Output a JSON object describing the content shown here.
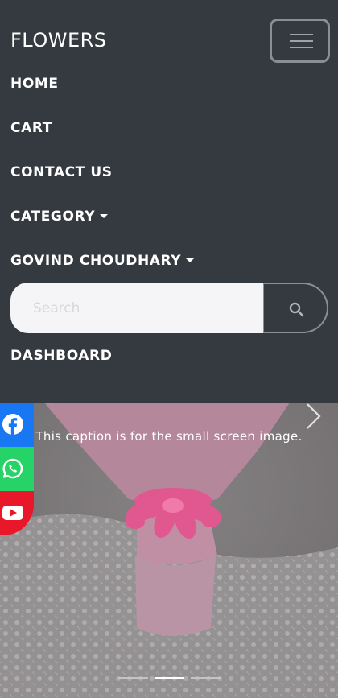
{
  "navbar": {
    "brand": "FLOWERS",
    "items": [
      {
        "label": "HOME"
      },
      {
        "label": "CART"
      },
      {
        "label": "CONTACT US"
      },
      {
        "label": "CATEGORY"
      },
      {
        "label": "GOVIND CHOUDHARY"
      },
      {
        "label": "DASHBOARD"
      }
    ],
    "search": {
      "placeholder": "Search",
      "value": ""
    },
    "toggler_icon": "hamburger-icon",
    "search_icon": "search-icon"
  },
  "carousel": {
    "caption": "This caption is for the small screen image.",
    "slide_count": 3,
    "active_index": 1,
    "next_icon": "chevron-right-icon"
  },
  "social": [
    {
      "network": "facebook",
      "icon": "facebook-icon",
      "color": "#1877f2"
    },
    {
      "network": "whatsapp",
      "icon": "whatsapp-icon",
      "color": "#25d366"
    },
    {
      "network": "youtube",
      "icon": "youtube-icon",
      "color": "#e8182a"
    }
  ],
  "colors": {
    "navbar_bg": "#343a40",
    "text": "#ffffff"
  }
}
